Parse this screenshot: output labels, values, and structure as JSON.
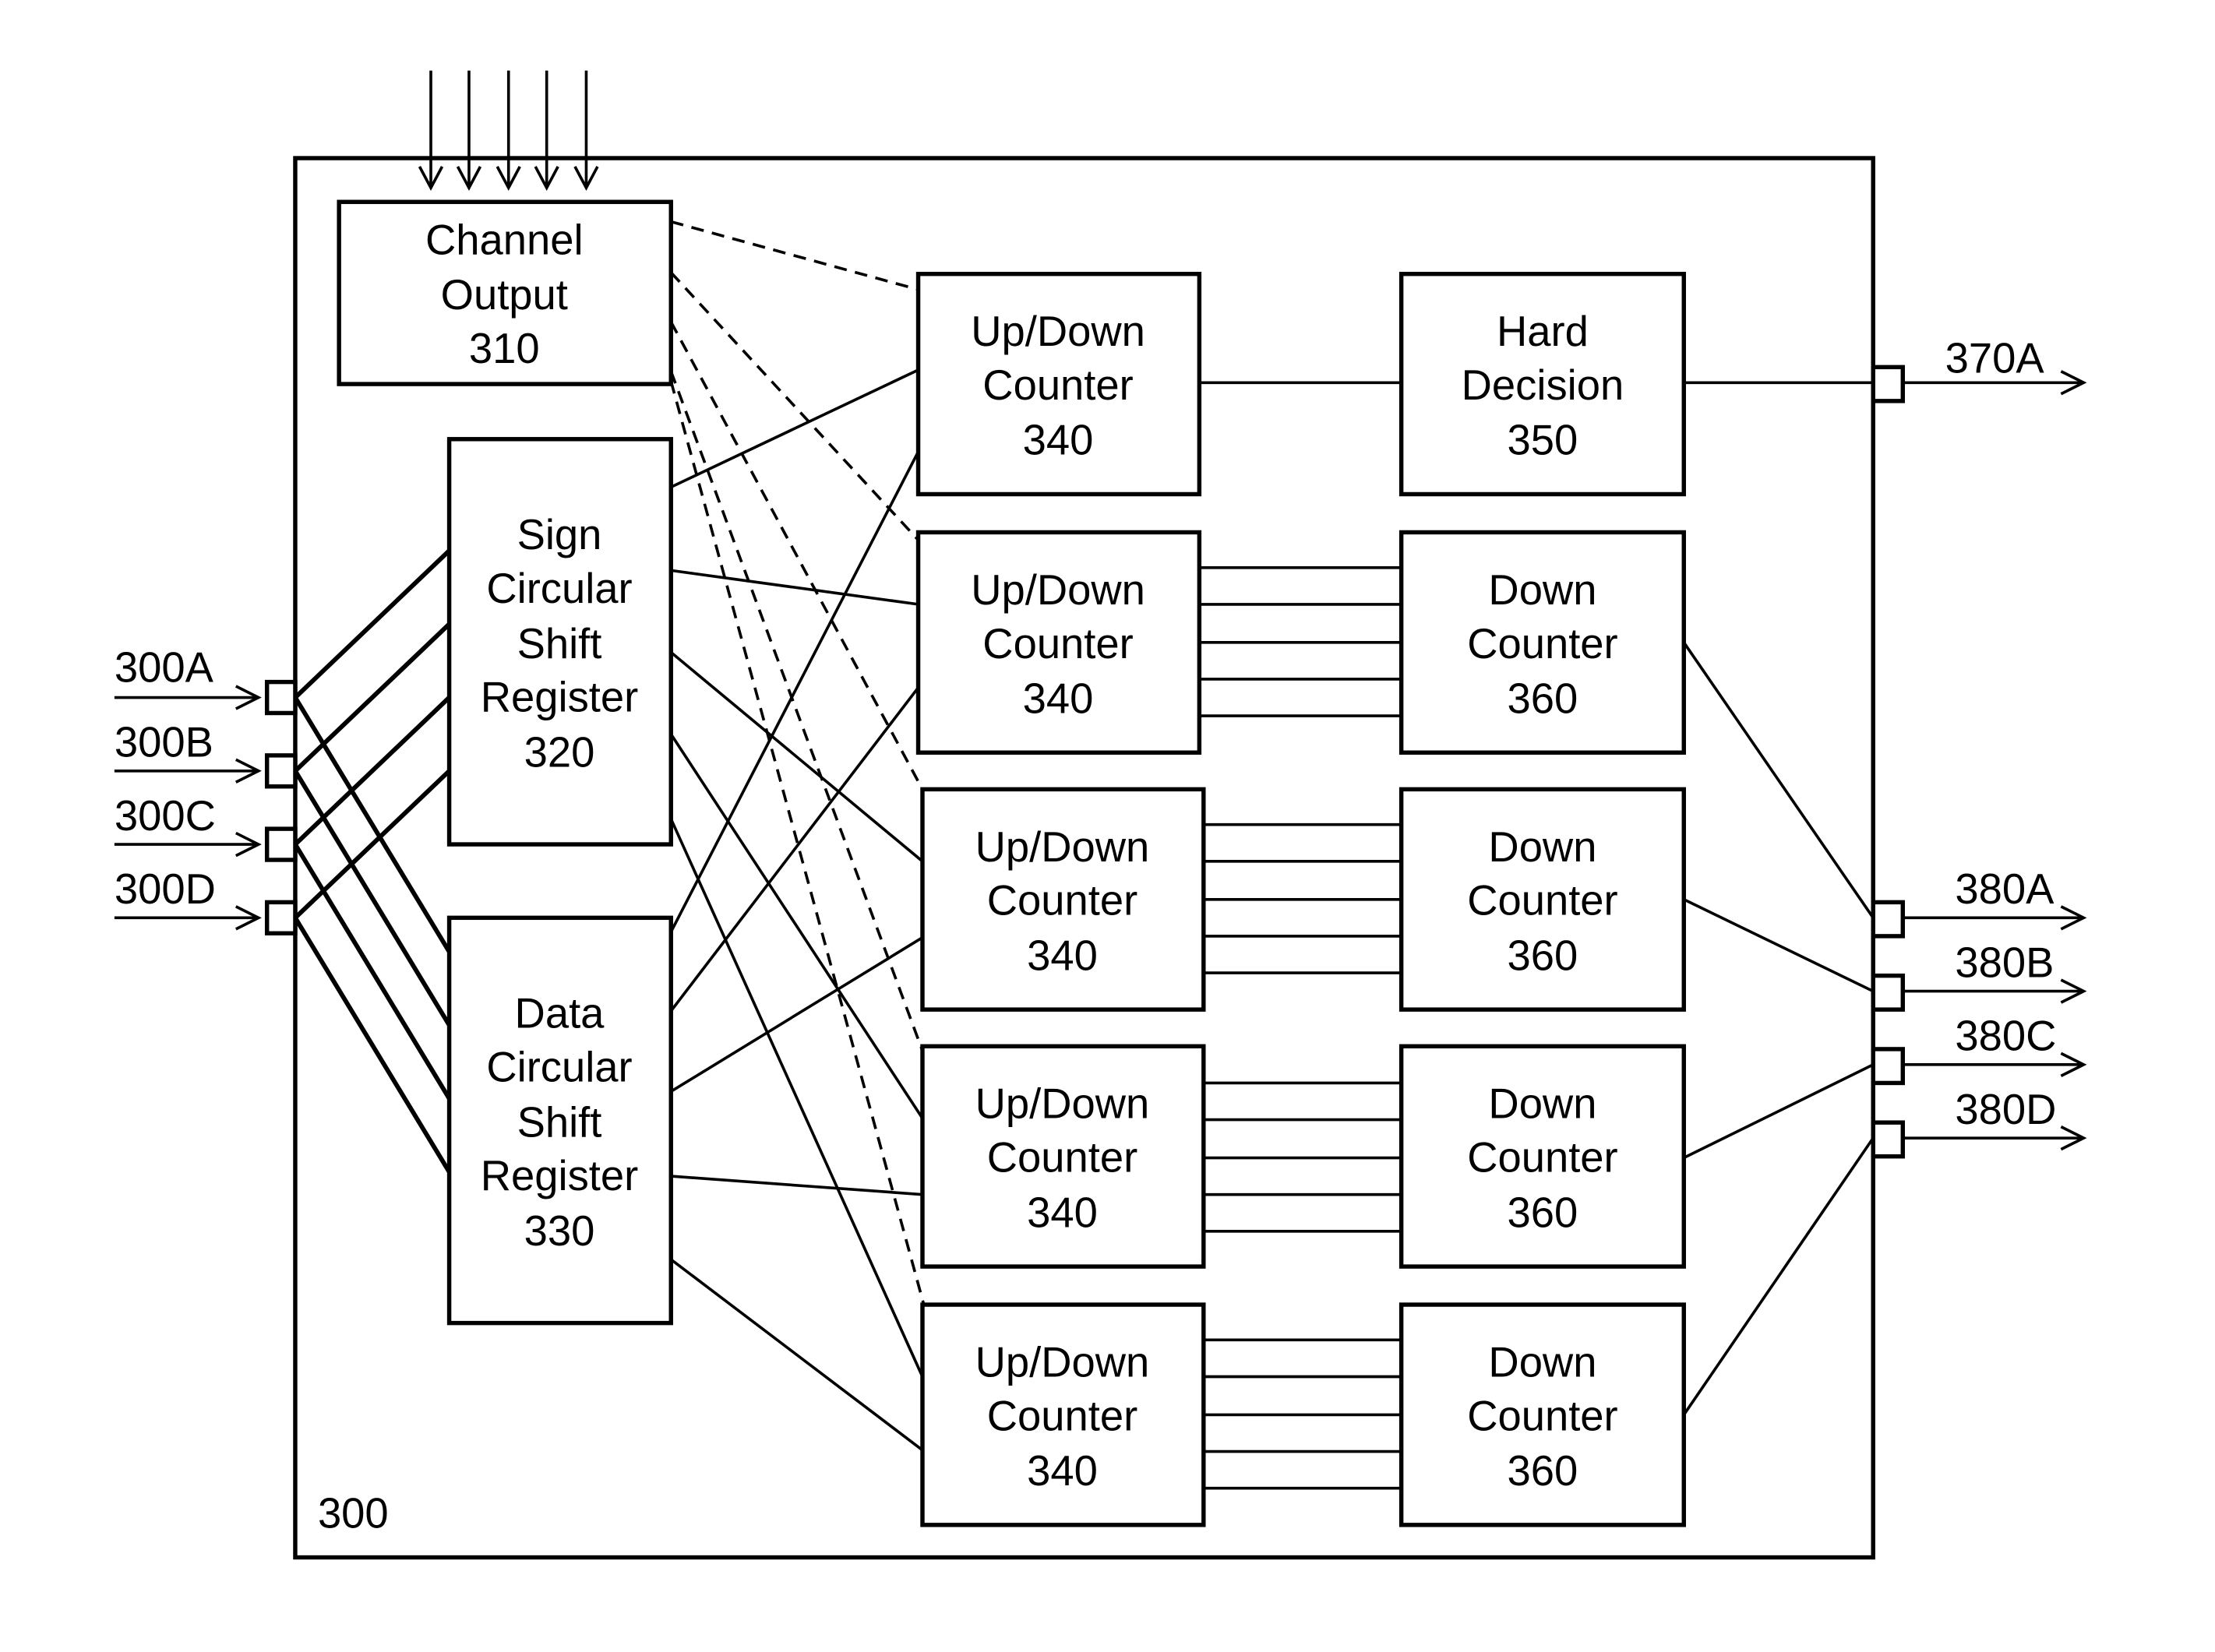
{
  "diagram": {
    "system_label": "300",
    "inputs": [
      "300A",
      "300B",
      "300C",
      "300D"
    ],
    "outputs_hard": [
      "370A"
    ],
    "outputs_soft": [
      "380A",
      "380B",
      "380C",
      "380D"
    ],
    "channel_output": [
      "Channel",
      "Output",
      "310"
    ],
    "sign_register": [
      "Sign",
      "Circular",
      "Shift",
      "Register",
      "320"
    ],
    "data_register": [
      "Data",
      "Circular",
      "Shift",
      "Register",
      "330"
    ],
    "updown_counters": [
      [
        "Up/Down",
        "Counter",
        "340"
      ],
      [
        "Up/Down",
        "Counter",
        "340"
      ],
      [
        "Up/Down",
        "Counter",
        "340"
      ],
      [
        "Up/Down",
        "Counter",
        "340"
      ],
      [
        "Up/Down",
        "Counter",
        "340"
      ]
    ],
    "hard_decision": [
      "Hard",
      "Decision",
      "350"
    ],
    "down_counters": [
      [
        "Down",
        "Counter",
        "360"
      ],
      [
        "Down",
        "Counter",
        "360"
      ],
      [
        "Down",
        "Counter",
        "360"
      ],
      [
        "Down",
        "Counter",
        "360"
      ]
    ],
    "channel_input_arrows": 5
  }
}
